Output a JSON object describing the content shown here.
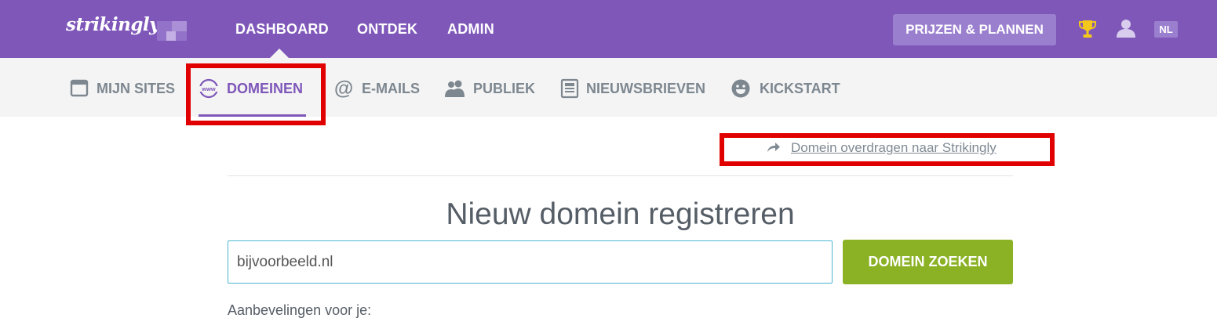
{
  "brand": {
    "logo_text": "strikingly",
    "color": "#7e57b9"
  },
  "topnav": {
    "items": [
      {
        "label": "DASHBOARD",
        "active": true
      },
      {
        "label": "ONTDEK"
      },
      {
        "label": "ADMIN"
      }
    ],
    "pricing_label": "PRIJZEN & PLANNEN",
    "trophy_icon": "trophy-icon",
    "user_icon": "user-icon",
    "language": "NL"
  },
  "subnav": {
    "items": [
      {
        "label": "MIJN SITES",
        "icon": "browser-window-icon"
      },
      {
        "label": "DOMEINEN",
        "icon": "www-globe-icon",
        "active": true
      },
      {
        "label": "E-MAILS",
        "icon": "at-sign-icon"
      },
      {
        "label": "PUBLIEK",
        "icon": "people-icon"
      },
      {
        "label": "NIEUWSBRIEVEN",
        "icon": "newsletter-icon"
      },
      {
        "label": "KICKSTART",
        "icon": "smiley-icon"
      }
    ]
  },
  "main": {
    "transfer_link": "Domein overdragen naar Strikingly",
    "heading": "Nieuw domein registreren",
    "search": {
      "value": "bijvoorbeeld.nl",
      "placeholder": ""
    },
    "search_button": "DOMEIN ZOEKEN",
    "recommendations_label": "Aanbevelingen voor je:"
  },
  "colors": {
    "topbar": "#7e57b9",
    "subbar": "#f4f4f4",
    "search_button": "#8ab224",
    "input_border": "#4bb6d2",
    "annotation": "#e10000"
  }
}
